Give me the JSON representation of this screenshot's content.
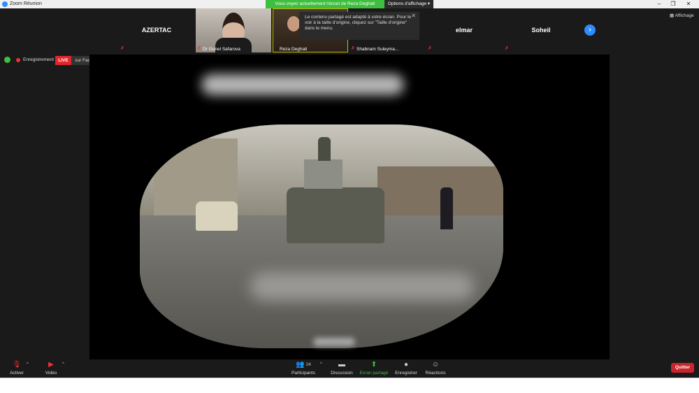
{
  "window": {
    "title": "Zoom Réunion"
  },
  "top_bar": {
    "share_notice": "Vous voyez actuellement l'écran de Reza Deghati",
    "view_options": "Options d'affichage"
  },
  "participants_strip": {
    "tiles": [
      {
        "name": "AZERTAC"
      },
      {
        "name": "Dr Gunel Safarova"
      },
      {
        "name": "Reza Deghati"
      },
      {
        "name": "Shabnam Suleyma..."
      },
      {
        "name": "elmar"
      },
      {
        "name": "Soheil"
      }
    ],
    "tooltip": "Le contenu partagé est adapté à votre écran. Pour le voir à la taille d'origine, cliquez sur \"Taille d'origine\" dans le menu.",
    "affichage": "Affichage"
  },
  "recording": {
    "label": "Enregistrement",
    "live_badge": "LIVE",
    "live_target": "sur Facebook"
  },
  "toolbar": {
    "mute": "Activer",
    "video": "Vidéo",
    "participants": "Participants",
    "participants_count": "24",
    "chat": "Discussion",
    "share": "Ecran partagé",
    "record": "Enregistrer",
    "reactions": "Réactions",
    "leave": "Quitter"
  },
  "colors": {
    "accent": "#2d8cff",
    "share_green": "#3fbf3f",
    "leave_red": "#c8252c",
    "live_red": "#e0262b"
  }
}
